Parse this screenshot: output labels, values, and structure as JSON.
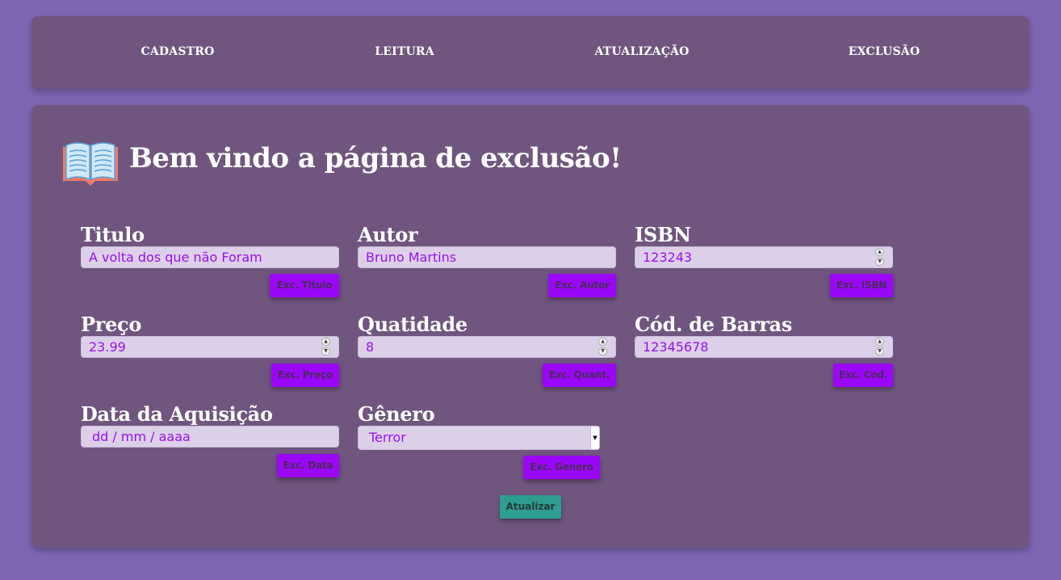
{
  "nav": {
    "items": [
      {
        "label": "CADASTRO"
      },
      {
        "label": "LEITURA"
      },
      {
        "label": "ATUALIZAÇÃO"
      },
      {
        "label": "EXCLUSÃO"
      }
    ]
  },
  "header": {
    "icon": "open-book-icon",
    "title": "Bem vindo a página de exclusão!"
  },
  "form": {
    "titulo": {
      "label": "Titulo",
      "value": "A volta dos que não Foram",
      "button": "Exc. Titulo"
    },
    "autor": {
      "label": "Autor",
      "value": "Bruno Martins",
      "button": "Exc. Autor"
    },
    "isbn": {
      "label": "ISBN",
      "value": "123243",
      "button": "Exc. ISBN"
    },
    "preco": {
      "label": "Preço",
      "value": "23.99",
      "button": "Exc. Preço"
    },
    "quantidade": {
      "label": "Quatidade",
      "value": "8",
      "button": "Exc. Quant."
    },
    "codigo_barras": {
      "label": "Cód. de Barras",
      "value": "12345678",
      "button": "Exc. Cod."
    },
    "data_aquisicao": {
      "label": "Data da Aquisição",
      "placeholder": "dd / mm / aaaa",
      "button": "Exc. Data"
    },
    "genero": {
      "label": "Gênero",
      "selected": "Terror",
      "button": "Exc. Genero"
    },
    "submit": "Atualizar"
  },
  "colors": {
    "background": "#7e66b4",
    "panel": "#70567f",
    "input_bg": "#dcd0e8",
    "input_text": "#9a10e8",
    "exc_button": "#9b07f9",
    "update_button": "#2d9e90"
  }
}
